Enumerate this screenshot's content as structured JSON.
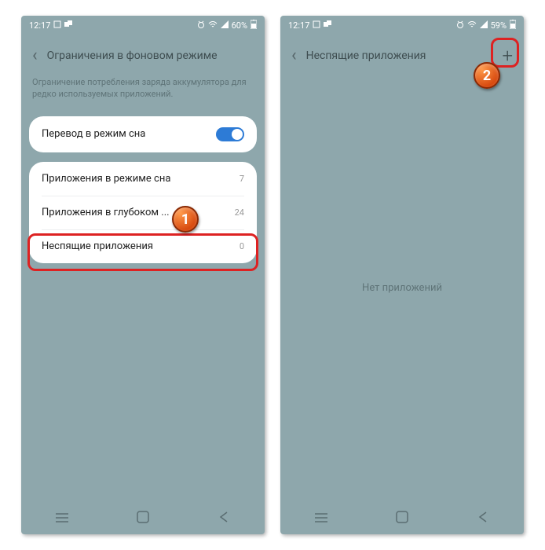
{
  "phone1": {
    "status": {
      "time": "12:17",
      "battery_text": "60%"
    },
    "header": {
      "title": "Ограничения в фоновом режиме"
    },
    "subtitle": "Ограничение потребления заряда аккумулятора для редко используемых приложений.",
    "toggle": {
      "label": "Перевод в режим сна"
    },
    "rows": [
      {
        "label": "Приложения в режиме сна",
        "count": "7"
      },
      {
        "label": "Приложения в глубоком ...",
        "count": "24"
      },
      {
        "label": "Неспящие приложения",
        "count": "0"
      }
    ],
    "badge": "1"
  },
  "phone2": {
    "status": {
      "time": "12:17",
      "battery_text": "59%"
    },
    "header": {
      "title": "Неспящие приложения"
    },
    "empty": "Нет приложений",
    "badge": "2"
  }
}
